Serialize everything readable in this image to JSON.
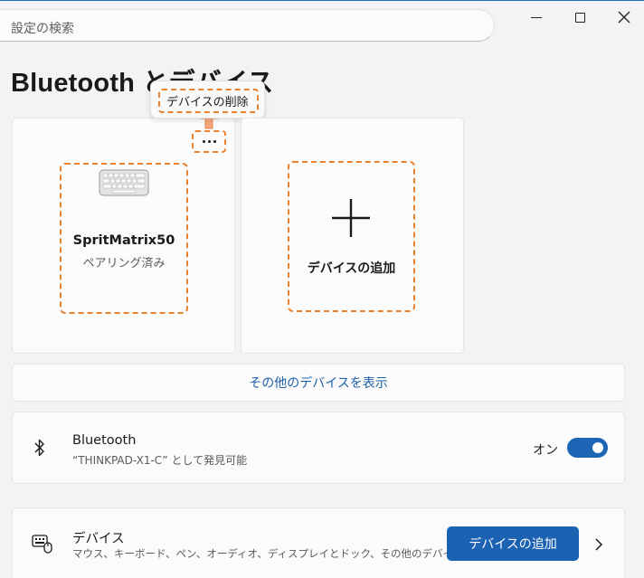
{
  "search": {
    "placeholder": "設定の検索"
  },
  "page": {
    "title": "Bluetooth とデバイス"
  },
  "paired_device": {
    "name": "SpritMatrix50",
    "status": "ペアリング済み",
    "icon": "keyboard-icon",
    "more_icon": "more-options-icon"
  },
  "context_menu": {
    "remove_label": "デバイスの削除"
  },
  "add_card": {
    "label": "デバイスの追加",
    "icon": "plus-icon"
  },
  "show_more": {
    "label": "その他のデバイスを表示"
  },
  "bluetooth": {
    "title": "Bluetooth",
    "subtitle": "“THINKPAD-X1-C” として発見可能",
    "toggle_label": "オン",
    "toggle_on": true,
    "icon": "bluetooth-icon"
  },
  "devices": {
    "title": "デバイス",
    "subtitle": "マウス、キーボード、ペン、オーディオ、ディスプレイとドック、その他のデバイス",
    "button_label": "デバイスの追加",
    "icon": "devices-icon"
  },
  "colors": {
    "accent": "#1b62b3",
    "annotation": "#e8822f",
    "link": "#1d5fa8"
  }
}
